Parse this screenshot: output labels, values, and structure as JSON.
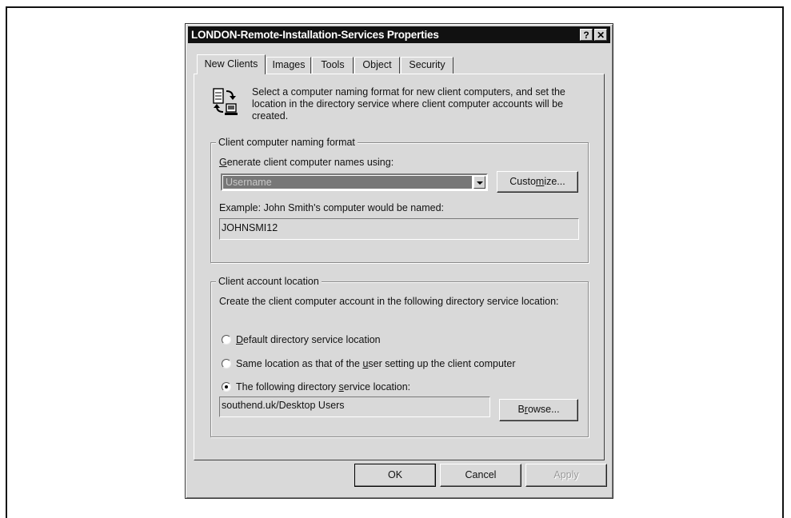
{
  "dialog": {
    "title": "LONDON-Remote-Installation-Services Properties",
    "help_button": "?",
    "close_button": "✕"
  },
  "tabs": [
    {
      "label": "New Clients",
      "active": true
    },
    {
      "label": "Images",
      "active": false
    },
    {
      "label": "Tools",
      "active": false
    },
    {
      "label": "Object",
      "active": false
    },
    {
      "label": "Security",
      "active": false
    }
  ],
  "description": "Select a computer naming format for new client computers, and set the location in the directory service where client computer accounts will be created.",
  "naming_group": {
    "title": "Client computer naming format",
    "generate_label_prefix": "G",
    "generate_label_rest": "enerate client computer names using:",
    "selected_format": "Username",
    "customize_pre": "Custo",
    "customize_u": "m",
    "customize_post": "ize...",
    "example_label": "Example: John Smith's computer would be named:",
    "example_value": "JOHNSMI12"
  },
  "location_group": {
    "title": "Client account location",
    "instructions": "Create the client computer account in the following directory service location:",
    "options": [
      {
        "pre": "",
        "u": "D",
        "post": "efault directory service location",
        "checked": false
      },
      {
        "pre": "Same location as that of the ",
        "u": "u",
        "post": "ser setting up the client computer",
        "checked": false
      },
      {
        "pre": "The following directory ",
        "u": "s",
        "post": "ervice location:",
        "checked": true
      }
    ],
    "path_value": "southend.uk/Desktop Users",
    "browse_pre": "B",
    "browse_u": "r",
    "browse_post": "owse..."
  },
  "footer": {
    "ok": "OK",
    "cancel": "Cancel",
    "apply": "Apply"
  }
}
